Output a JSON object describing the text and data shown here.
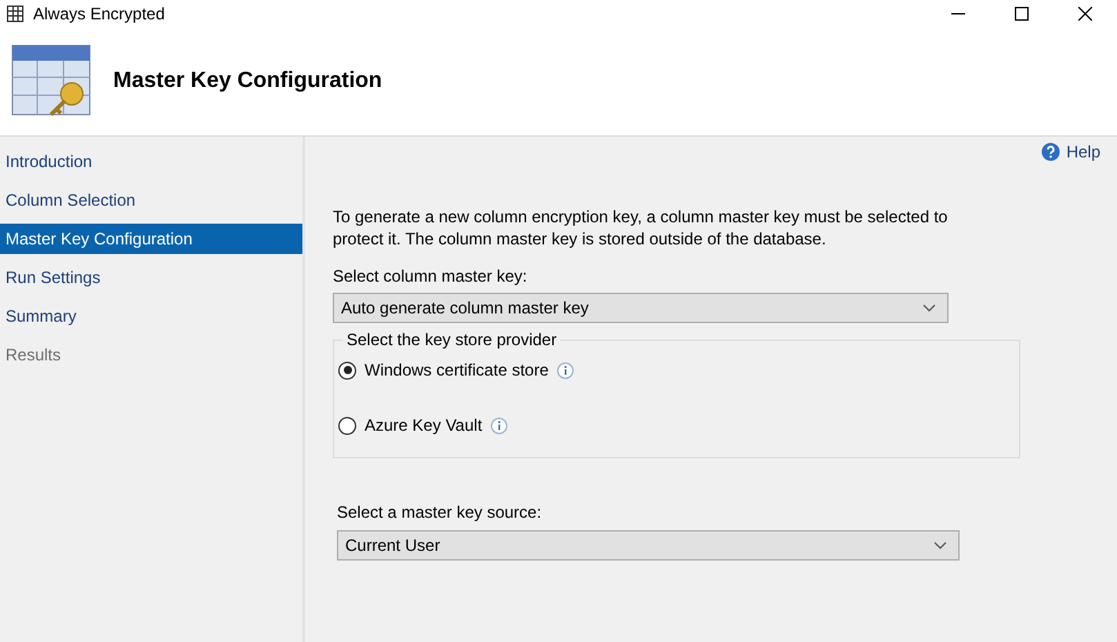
{
  "window": {
    "title": "Always Encrypted"
  },
  "header": {
    "title": "Master Key Configuration"
  },
  "sidebar": {
    "items": [
      {
        "label": "Introduction",
        "selected": false,
        "disabled": false
      },
      {
        "label": "Column Selection",
        "selected": false,
        "disabled": false
      },
      {
        "label": "Master Key Configuration",
        "selected": true,
        "disabled": false
      },
      {
        "label": "Run Settings",
        "selected": false,
        "disabled": false
      },
      {
        "label": "Summary",
        "selected": false,
        "disabled": false
      },
      {
        "label": "Results",
        "selected": false,
        "disabled": true
      }
    ]
  },
  "help": {
    "label": "Help"
  },
  "description": "To generate a new column encryption key, a column master key must be selected to protect it.  The column master key is stored outside of the database.",
  "master_key": {
    "label": "Select column master key:",
    "value": "Auto generate column master key"
  },
  "provider_group": {
    "legend": "Select the key store provider",
    "options": [
      {
        "label": "Windows certificate store",
        "selected": true
      },
      {
        "label": "Azure Key Vault",
        "selected": false
      }
    ]
  },
  "key_source": {
    "label": "Select a master key source:",
    "value": "Current User"
  }
}
